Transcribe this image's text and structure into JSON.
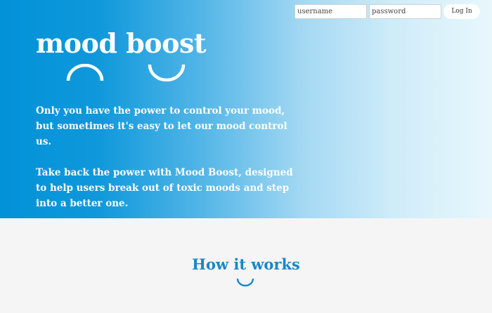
{
  "login": {
    "username_placeholder": "username",
    "password_placeholder": "password",
    "login_label": "Log In"
  },
  "hero": {
    "logo_text": "mood boost",
    "paragraph_1": "Only you have the power to control your mood, but sometimes it's easy to let our mood control us.",
    "paragraph_2": "Take back the power with Mood Boost, designed to help users break out of toxic moods and step into a better one."
  },
  "how_it_works": {
    "title": "How it works"
  },
  "colors": {
    "hero_gradient_start": "#0292d8",
    "hero_gradient_end": "#e8f7fc",
    "heading_blue": "#1a86c9",
    "section_background": "#f5f5f5",
    "text_on_hero": "#ffffff"
  },
  "icons": {
    "frown": "frown-arc-icon",
    "smile": "smile-arc-icon",
    "section_smile": "smile-arc-icon"
  }
}
